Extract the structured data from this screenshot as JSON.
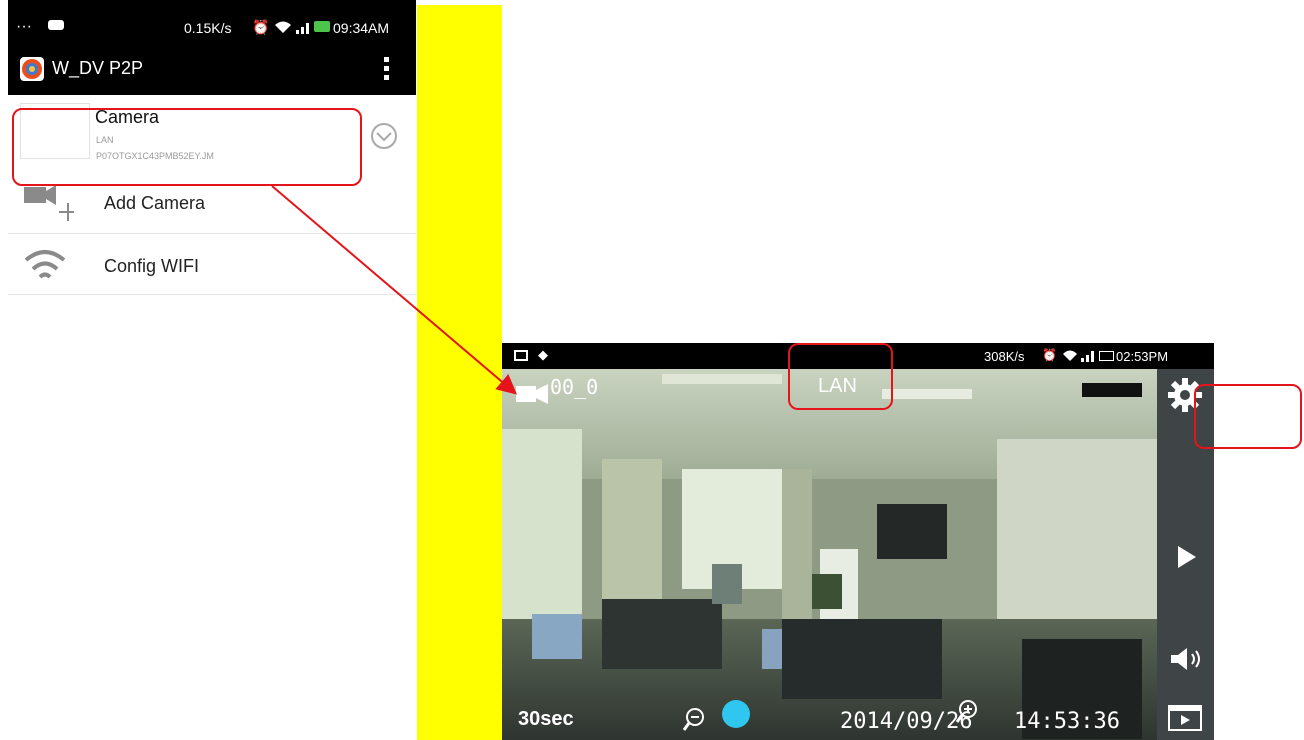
{
  "left_phone": {
    "status_bar": {
      "icons_left": "···",
      "network_speed": "0.15K/s",
      "time": "09:34AM"
    },
    "action_bar": {
      "app_title": "W_DV P2P",
      "overflow_icon": "three-dot-menu"
    },
    "camera_item": {
      "name": "Camera",
      "status": "LAN",
      "uid": "P07OTGX1C43PMB52EY.JM",
      "action_icon": "circle-down-icon"
    },
    "menu": [
      {
        "label": "Add Camera",
        "icon": "add-camera-icon"
      },
      {
        "label": "Config WIFI",
        "icon": "wifi-icon"
      }
    ]
  },
  "right_phone": {
    "status_bar": {
      "network_speed": "308K/s",
      "time": "02:53PM"
    },
    "video": {
      "camera_id": "00_0",
      "connection": "LAN",
      "record_duration": "30sec",
      "date": "2014/09/26",
      "time": "14:53:36"
    },
    "sidebar": [
      {
        "icon": "gear-icon"
      },
      {
        "icon": "play-icon"
      },
      {
        "icon": "speaker-icon"
      },
      {
        "icon": "video-list-icon"
      }
    ]
  },
  "colors": {
    "highlight": "#e4141a",
    "accent_divider": "#ffff00",
    "status_bar": "#000000",
    "ptz_dot": "#2fc6ef"
  }
}
